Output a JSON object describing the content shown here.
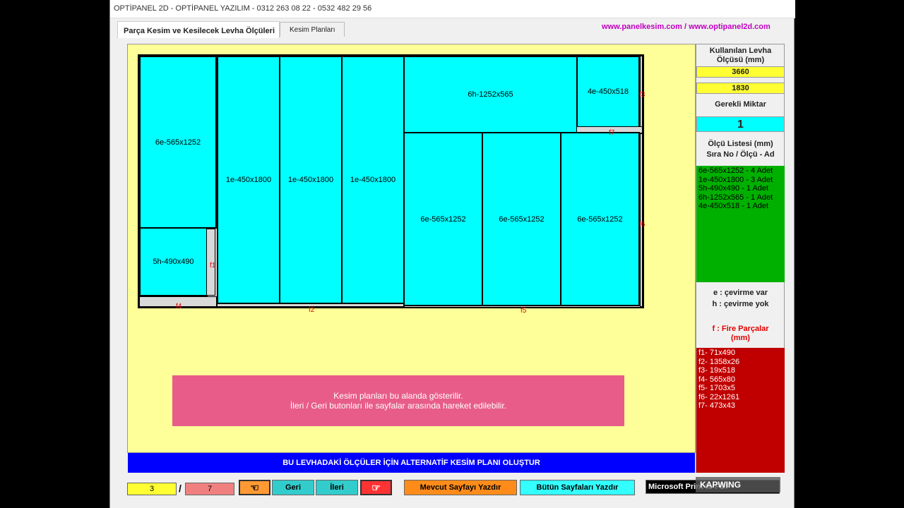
{
  "window": {
    "title": "OPTİPANEL 2D - OPTİPANEL YAZILIM - 0312 263 08 22 - 0532 482 29 56"
  },
  "tabs": {
    "tab1": "Parça Kesim ve Kesilecek Levha Ölçüleri",
    "tab2": "Kesim Planları"
  },
  "website": "www.panelkesim.com / www.optipanel2d.com",
  "pieces": {
    "p1": "6e-565x1252",
    "p2": "5h-490x490",
    "p3": "1e-450x1800",
    "p4": "1e-450x1800",
    "p5": "1e-450x1800",
    "p6": "6h-1252x565",
    "p7": "4e-450x518",
    "p8": "6e-565x1252",
    "p9": "6e-565x1252",
    "p10": "6e-565x1252"
  },
  "scrap_labels": {
    "f1": "f1",
    "f2": "f2",
    "f3": "f3",
    "f4": "f4",
    "f5": "f5",
    "f6": "f6",
    "f7": "f7"
  },
  "info": {
    "line1": "Kesim planları bu alanda gösterilir.",
    "line2": "İleri / Geri butonları ile sayfalar arasında hareket edilebilir."
  },
  "alt_button": "BU LEVHADAKİ ÖLÇÜLER İÇİN ALTERNATİF KESİM PLANI OLUŞTUR",
  "panel": {
    "sheet_title": "Kullanılan Levha Ölçüsü (mm)",
    "sheet_w": "3660",
    "sheet_h": "1830",
    "qty_title": "Gerekli Miktar",
    "qty_value": "1",
    "list_title1": "Ölçü Listesi (mm)",
    "list_title2": "Sıra No / Ölçü - Ad",
    "list": [
      "6e-565x1252 - 4 Adet",
      "1e-450x1800 - 3 Adet",
      "5h-490x490 - 1 Adet",
      "6h-1252x565 - 1 Adet",
      "4e-450x518 - 1 Adet"
    ],
    "legend1": "e : çevirme var",
    "legend2": "h : çevirme yok",
    "fire_title": "f : Fire Parçalar (mm)",
    "fire_list": [
      "f1- 71x490",
      "f2- 1358x26",
      "f3- 19x518",
      "f4- 565x80",
      "f5- 1703x5",
      "f6- 22x1261",
      "f7- 473x43"
    ]
  },
  "nav": {
    "current_page": "3",
    "separator": "/",
    "total_pages": "7",
    "back_label": "Geri",
    "next_label": "İleri",
    "print_current": "Mevcut Sayfayı Yazdır",
    "print_all": "Bütün Sayfaları Yazdır",
    "printer": "Microsoft Print to PDF"
  },
  "watermark": "KAPWING",
  "colors": {
    "cyan": "#00ffff",
    "yellow_bg": "#ffff99",
    "scrap_red": "#e00000",
    "blue_btn": "#0000ff",
    "pink_info": "#e85c8a",
    "green_list": "#00b000",
    "red_list": "#c00000"
  }
}
